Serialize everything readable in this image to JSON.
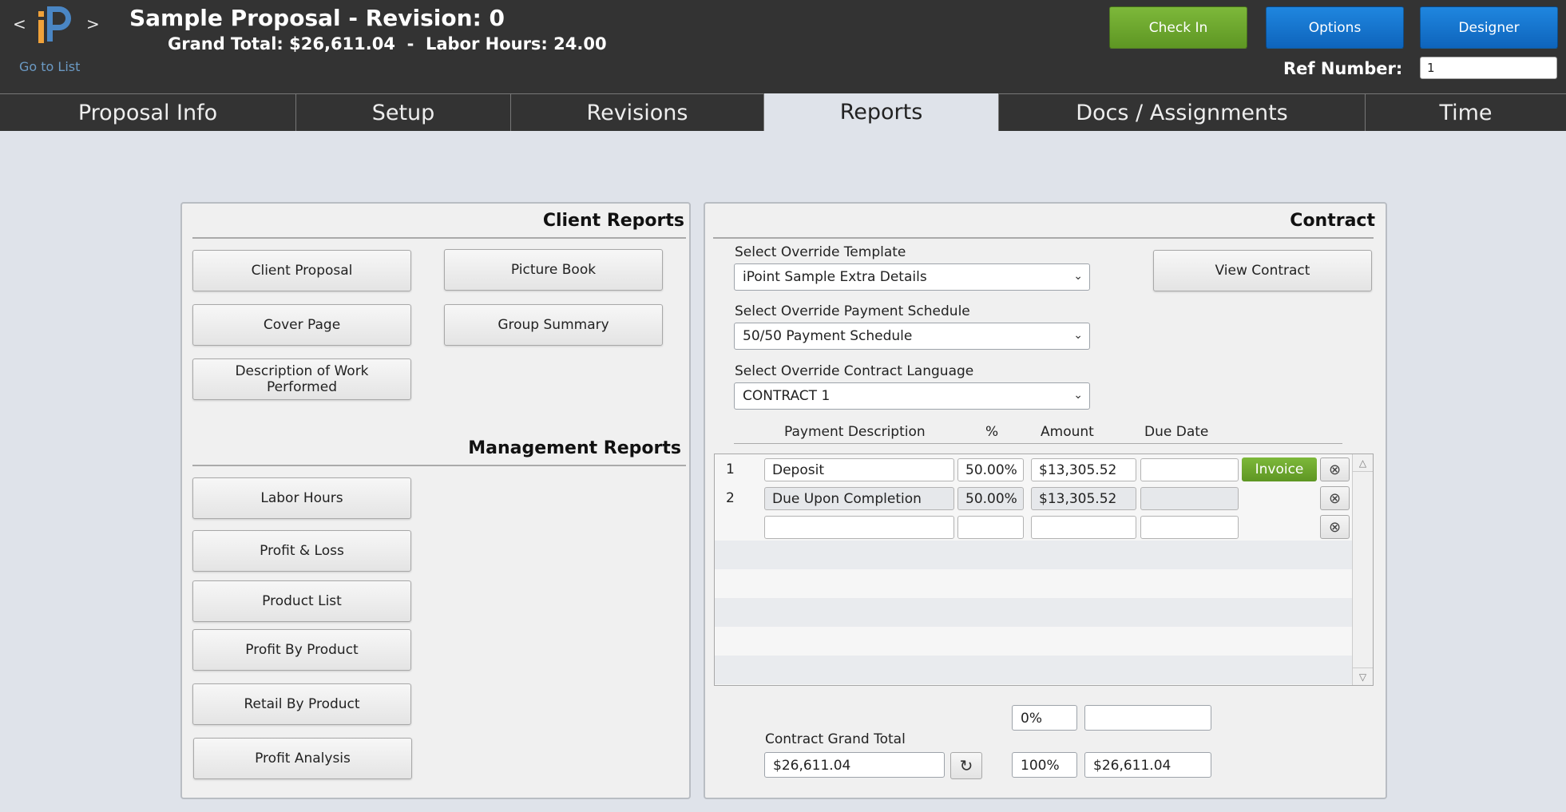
{
  "header": {
    "prev_arrow": "<",
    "next_arrow": ">",
    "go_to_list": "Go to List",
    "title": "Sample Proposal - Revision: 0",
    "subtitle": "Grand Total: $26,611.04  -  Labor Hours: 24.00",
    "buttons": {
      "check_in": "Check In",
      "options": "Options",
      "designer": "Designer"
    },
    "ref_number_label": "Ref Number:",
    "ref_number_value": "1",
    "colors": {
      "bar": "#333333",
      "green": "#6aa52c",
      "blue": "#1577d0",
      "logo_orange": "#f0a23a",
      "logo_blue": "#4a86c4"
    }
  },
  "tabs": [
    {
      "label": "Proposal Info",
      "active": false
    },
    {
      "label": "Setup",
      "active": false
    },
    {
      "label": "Revisions",
      "active": false
    },
    {
      "label": "Reports",
      "active": true
    },
    {
      "label": "Docs / Assignments",
      "active": false
    },
    {
      "label": "Time",
      "active": false
    }
  ],
  "client_reports": {
    "title": "Client Reports",
    "buttons": [
      "Client Proposal",
      "Picture Book",
      "Cover Page",
      "Group Summary",
      "Description of Work Performed"
    ]
  },
  "management_reports": {
    "title": "Management Reports",
    "buttons": [
      "Labor Hours",
      "Profit & Loss",
      "Product List",
      "Profit By Product",
      "Retail By Product",
      "Profit Analysis"
    ]
  },
  "contract": {
    "title": "Contract",
    "view_contract": "View Contract",
    "override_template": {
      "label": "Select Override Template",
      "value": "iPoint Sample Extra Details"
    },
    "override_payment_schedule": {
      "label": "Select Override Payment Schedule",
      "value": "50/50 Payment Schedule"
    },
    "override_contract_language": {
      "label": "Select Override Contract Language",
      "value": "CONTRACT 1"
    },
    "columns": [
      "Payment Description",
      "%",
      "Amount",
      "Due Date"
    ],
    "payments": [
      {
        "num": "1",
        "description": "Deposit",
        "percent": "50.00%",
        "amount": "$13,305.52",
        "due_date": "",
        "invoice": "Invoice"
      },
      {
        "num": "2",
        "description": "Due Upon Completion",
        "percent": "50.00%",
        "amount": "$13,305.52",
        "due_date": ""
      },
      {
        "num": "",
        "description": "",
        "percent": "",
        "amount": "",
        "due_date": ""
      }
    ],
    "remaining_percent": "0%",
    "remaining_amount": "",
    "grand_total_label": "Contract Grand Total",
    "grand_total_value": "$26,611.04",
    "total_percent": "100%",
    "total_amount": "$26,611.04"
  }
}
